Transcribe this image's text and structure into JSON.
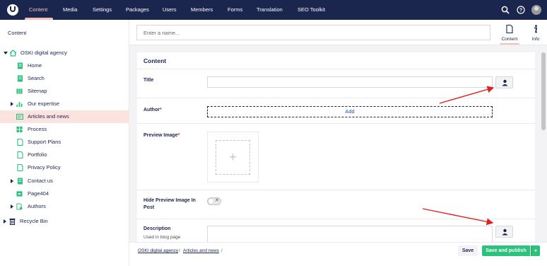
{
  "topbar": {
    "logo_name": "umbraco-logo",
    "nav": [
      {
        "label": "Content",
        "active": true
      },
      {
        "label": "Media"
      },
      {
        "label": "Settings"
      },
      {
        "label": "Packages"
      },
      {
        "label": "Users"
      },
      {
        "label": "Members"
      },
      {
        "label": "Forms"
      },
      {
        "label": "Translation"
      },
      {
        "label": "SEO Toolkit"
      }
    ],
    "icons": [
      "search-icon",
      "help-icon",
      "avatar"
    ]
  },
  "sidebar": {
    "title": "Content",
    "tree": [
      {
        "label": "OSKI digital agency",
        "icon": "home-icon",
        "expanded": true
      },
      {
        "label": "Home",
        "icon": "page-icon"
      },
      {
        "label": "Search",
        "icon": "page-icon"
      },
      {
        "label": "Sitemap",
        "icon": "sitemap-icon"
      },
      {
        "label": "Our expertise",
        "icon": "chart-icon",
        "collapsed": true
      },
      {
        "label": "Articles and news",
        "icon": "news-icon",
        "selected": true
      },
      {
        "label": "Process",
        "icon": "grid-icon"
      },
      {
        "label": "Support Plans",
        "icon": "page-icon"
      },
      {
        "label": "Portfolio",
        "icon": "page-icon"
      },
      {
        "label": "Privacy Policy",
        "icon": "page-icon"
      },
      {
        "label": "Contact us",
        "icon": "page-icon",
        "collapsed": true
      },
      {
        "label": "Page404",
        "icon": "box-icon"
      },
      {
        "label": "Authors",
        "icon": "authors-icon",
        "collapsed": true
      },
      {
        "label": "Recycle Bin",
        "icon": "trash-icon",
        "collapsed": true
      }
    ]
  },
  "header": {
    "name_placeholder": "Enter a name...",
    "apps": [
      {
        "label": "Content",
        "icon": "document-icon",
        "active": true
      },
      {
        "label": "Info",
        "icon": "info-icon"
      }
    ]
  },
  "panel": {
    "title": "Content",
    "properties": {
      "title_label": "Title",
      "author_label": "Author",
      "author_required": "*",
      "author_add": "Add",
      "preview_label": "Preview Image",
      "preview_required": "*",
      "hide_preview_label": "Hide Preview Image In Post",
      "description_label": "Description",
      "description_desc": "Used in blog page"
    }
  },
  "footer": {
    "breadcrumbs": [
      "OSKI digital agency",
      "Articles and news"
    ],
    "separator": "/",
    "save_label": "Save",
    "publish_label": "Save and publish"
  },
  "colors": {
    "topbar": "#1b264f",
    "accent": "#f5c1bc",
    "success": "#2bc37c",
    "annotation_arrow": "#e02020",
    "tree_icon": "#2bc37c"
  }
}
